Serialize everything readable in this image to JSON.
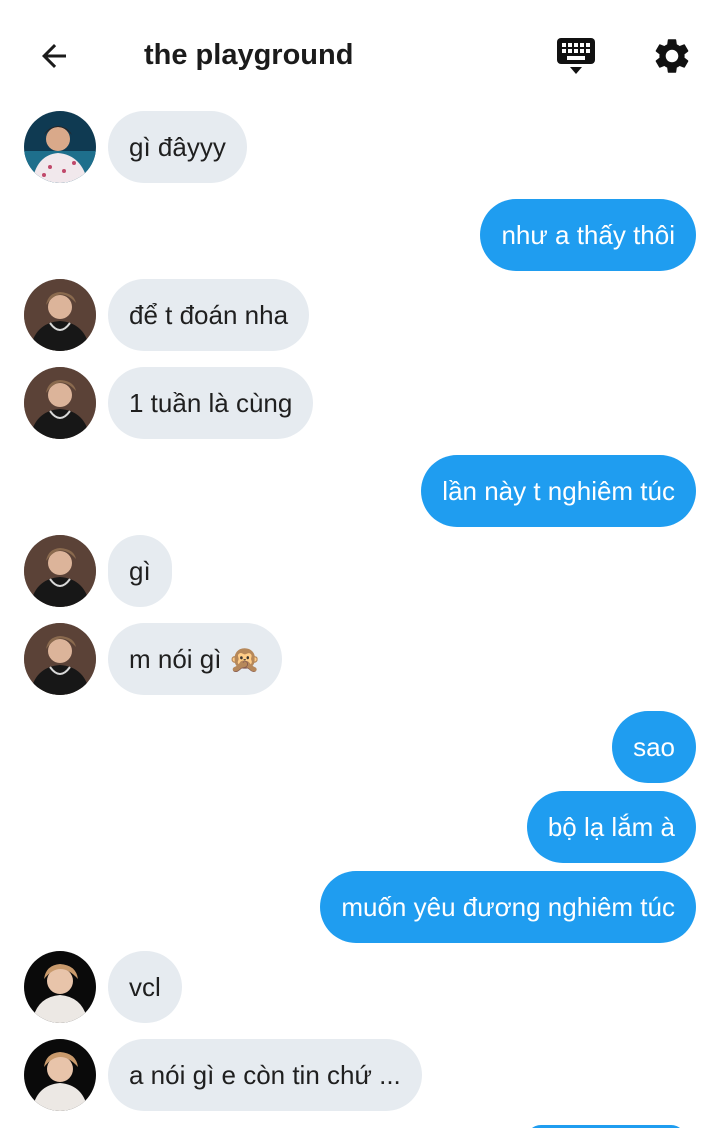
{
  "header": {
    "title": "the playground",
    "back_icon": "arrow-left-icon",
    "keyboard_icon": "keyboard-icon",
    "settings_icon": "gear-icon"
  },
  "colors": {
    "outgoing_bubble": "#1f9df0",
    "incoming_bubble": "#e6ebf0",
    "text_dark": "#1f1f1f"
  },
  "messages": [
    {
      "side": "in",
      "text": "gì đâyyy",
      "avatar": "avatar-1"
    },
    {
      "side": "out",
      "text": "như a thấy thôi"
    },
    {
      "side": "in",
      "text": "để t đoán nha",
      "avatar": "avatar-2"
    },
    {
      "side": "in",
      "text": "1 tuần là cùng",
      "avatar": "avatar-2"
    },
    {
      "side": "out",
      "text": "lần này t nghiêm túc"
    },
    {
      "side": "in",
      "text": "gì",
      "avatar": "avatar-2"
    },
    {
      "side": "in",
      "text": "m nói gì 🙊",
      "avatar": "avatar-2"
    },
    {
      "side": "out",
      "text": "sao"
    },
    {
      "side": "out",
      "text": "bộ lạ lắm à"
    },
    {
      "side": "out",
      "text": "muốn yêu đương nghiêm túc"
    },
    {
      "side": "in",
      "text": "vcl",
      "avatar": "avatar-3"
    },
    {
      "side": "in",
      "text": "a nói gì e còn tin chứ ...",
      "avatar": "avatar-3"
    }
  ]
}
